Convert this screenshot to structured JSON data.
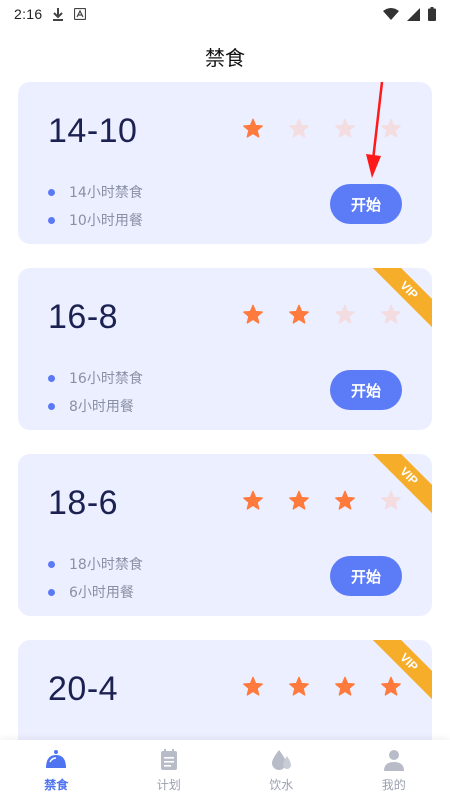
{
  "status_bar": {
    "time": "2:16"
  },
  "header": {
    "title": "禁食"
  },
  "plans": [
    {
      "name": "14-10",
      "rating": 1,
      "max_rating": 4,
      "fast_text": "14小时禁食",
      "eat_text": "10小时用餐",
      "button_label": "开始",
      "vip": false
    },
    {
      "name": "16-8",
      "rating": 2,
      "max_rating": 4,
      "fast_text": "16小时禁食",
      "eat_text": "8小时用餐",
      "button_label": "开始",
      "vip": true,
      "vip_label": "VIP"
    },
    {
      "name": "18-6",
      "rating": 3,
      "max_rating": 4,
      "fast_text": "18小时禁食",
      "eat_text": "6小时用餐",
      "button_label": "开始",
      "vip": true,
      "vip_label": "VIP"
    },
    {
      "name": "20-4",
      "rating": 4,
      "max_rating": 4,
      "vip": true,
      "vip_label": "VIP"
    }
  ],
  "tabs": [
    {
      "label": "禁食",
      "icon": "fasting-icon",
      "active": true
    },
    {
      "label": "计划",
      "icon": "plan-icon",
      "active": false
    },
    {
      "label": "饮水",
      "icon": "water-drop-icon",
      "active": false
    },
    {
      "label": "我的",
      "icon": "profile-icon",
      "active": false
    }
  ],
  "colors": {
    "accent": "#5b7cf6",
    "star_filled": "#ff7a3d",
    "star_empty": "#f3dde0",
    "vip": "#f5ad2a",
    "card_bg": "#ecefff",
    "annotation_arrow": "#ff1a1a"
  }
}
